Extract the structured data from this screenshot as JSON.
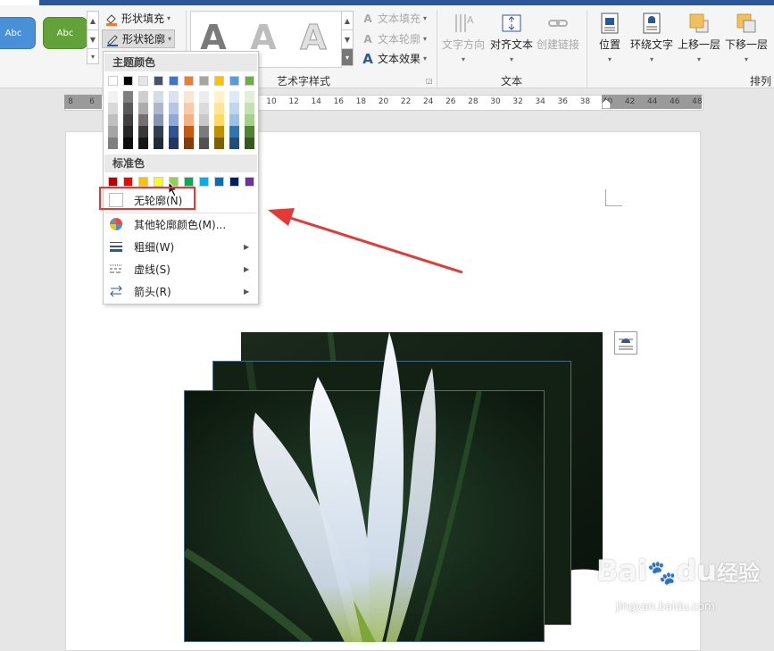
{
  "ribbon": {
    "style_buttons": [
      {
        "label": "Abc",
        "color": "#4a90d9"
      },
      {
        "label": "Abc",
        "color": "#63a13a"
      }
    ],
    "shape_fill_label": "形状填充",
    "shape_outline_label": "形状轮廓",
    "wordart_letter": "A",
    "text_fill_label": "文本填充",
    "text_outline_label": "文本轮廓",
    "text_effect_label": "文本效果",
    "wordart_group_label": "艺术字样式",
    "text_direction_label": "文字方向",
    "align_text_label": "对齐文本",
    "create_link_label": "创建链接",
    "text_group_label": "文本",
    "position_label": "位置",
    "wrap_text_label": "环绕文字",
    "bring_forward_label": "上移一层",
    "send_backward_label": "下移一层",
    "arrange_group_label": "排列"
  },
  "ruler": {
    "left_ticks": [
      "8",
      "6"
    ],
    "ticks": [
      "10",
      "12",
      "14",
      "16",
      "18",
      "20",
      "22",
      "24",
      "26",
      "28",
      "30",
      "32",
      "34",
      "36",
      "38",
      "40",
      "42",
      "44",
      "46",
      "48"
    ]
  },
  "menu": {
    "theme_colors_label": "主题颜色",
    "theme_top": [
      "#ffffff",
      "#000000",
      "#e7e6e6",
      "#44546a",
      "#4472c4",
      "#ed7d31",
      "#a5a5a5",
      "#ffc000",
      "#5b9bd5",
      "#70ad47"
    ],
    "theme_shades": [
      [
        "#f2f2f2",
        "#7f7f7f",
        "#d0cece",
        "#d6dce4",
        "#d9e2f3",
        "#fbe5d5",
        "#ededed",
        "#fff2cc",
        "#deebf6",
        "#e2efd9"
      ],
      [
        "#d8d8d8",
        "#595959",
        "#aeabab",
        "#adb9ca",
        "#b4c6e7",
        "#f7cbac",
        "#dbdbdb",
        "#fee599",
        "#bdd7ee",
        "#c5e0b3"
      ],
      [
        "#bfbfbf",
        "#3f3f3f",
        "#757070",
        "#8496b0",
        "#8eaadb",
        "#f4b183",
        "#c9c9c9",
        "#ffd965",
        "#9cc3e5",
        "#a8d08d"
      ],
      [
        "#a5a5a5",
        "#262626",
        "#3a3838",
        "#323f4f",
        "#2f5496",
        "#c55a11",
        "#7b7b7b",
        "#bf9000",
        "#2e75b5",
        "#538135"
      ],
      [
        "#7f7f7f",
        "#0c0c0c",
        "#171616",
        "#222a35",
        "#1f3864",
        "#833c0b",
        "#525252",
        "#7f6000",
        "#1e4e79",
        "#375623"
      ]
    ],
    "standard_colors_label": "标准色",
    "standard_colors": [
      "#c00000",
      "#ff0000",
      "#ffc000",
      "#ffff00",
      "#92d050",
      "#00b050",
      "#00b0f0",
      "#0070c0",
      "#002060",
      "#7030a0"
    ],
    "no_outline_label": "无轮廓(N)",
    "more_colors_label": "其他轮廓颜色(M)...",
    "weight_label": "粗细(W)",
    "dashes_label": "虚线(S)",
    "arrows_label": "箭头(R)"
  },
  "watermark": {
    "brand": "Bai",
    "brand_tail": "du",
    "brand_cn": "经验",
    "url": "jingyan.baidu.com"
  },
  "colors": {
    "accent_blue": "#2b579a",
    "highlight_red": "#e53935"
  }
}
